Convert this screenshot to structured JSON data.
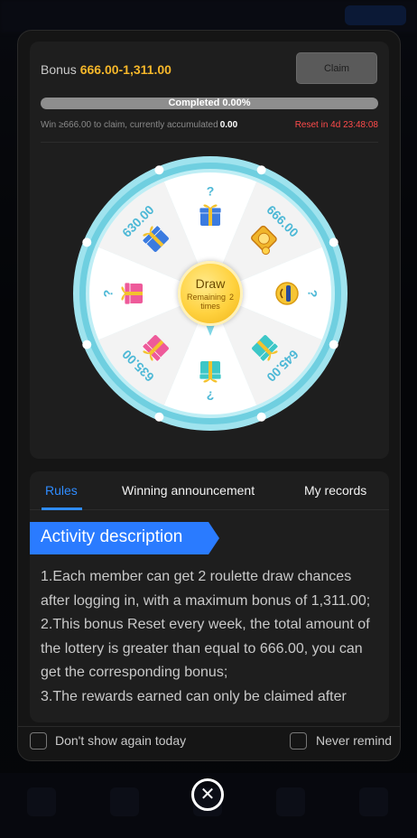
{
  "bonus": {
    "label": "Bonus",
    "amount": "666.00-1,311.00",
    "claim_label": "Claim"
  },
  "progress": {
    "text": "Completed 0.00%",
    "percent": 0
  },
  "info": {
    "win_text": "Win ≥666.00 to claim, currently accumulated",
    "accumulated": "0.00",
    "reset_text": "Reset in 4d 23:48:08"
  },
  "wheel": {
    "segments": [
      {
        "label": "?",
        "icon": "gift-box-blue-icon"
      },
      {
        "label": "666.00",
        "icon": "gold-coins-icon"
      },
      {
        "label": "?",
        "icon": "emoji-sunglasses-icon"
      },
      {
        "label": "645.00",
        "icon": "gift-box-teal-icon"
      },
      {
        "label": "?",
        "icon": "gift-box-teal-icon"
      },
      {
        "label": "635.00",
        "icon": "gift-box-pink-icon"
      },
      {
        "label": "?",
        "icon": "gift-box-pink-icon"
      },
      {
        "label": "630.00",
        "icon": "gift-box-blue-icon"
      }
    ],
    "draw_label": "Draw",
    "remaining_label": "Remaining",
    "times_label": "times",
    "remaining_count": "2"
  },
  "tabs": [
    {
      "label": "Rules",
      "active": true
    },
    {
      "label": "Winning announcement",
      "active": false
    },
    {
      "label": "My records",
      "active": false
    }
  ],
  "activity": {
    "title": "Activity description",
    "lines": [
      "1.Each member can get 2 roulette draw chances after logging in, with a maximum bonus of 1,311.00;",
      "2.This bonus Reset every week, the total amount of the lottery is greater than equal to 666.00, you can get the corresponding bonus;",
      "3.The rewards earned can only be claimed after"
    ]
  },
  "footer": {
    "dont_show_label": "Don't show again today",
    "never_remind_label": "Never remind"
  },
  "colors": {
    "accent": "#2f8cff",
    "gold": "#f6b72a",
    "reset_red": "#ff4b4b",
    "wheel_rim": "#7fd6e6"
  }
}
